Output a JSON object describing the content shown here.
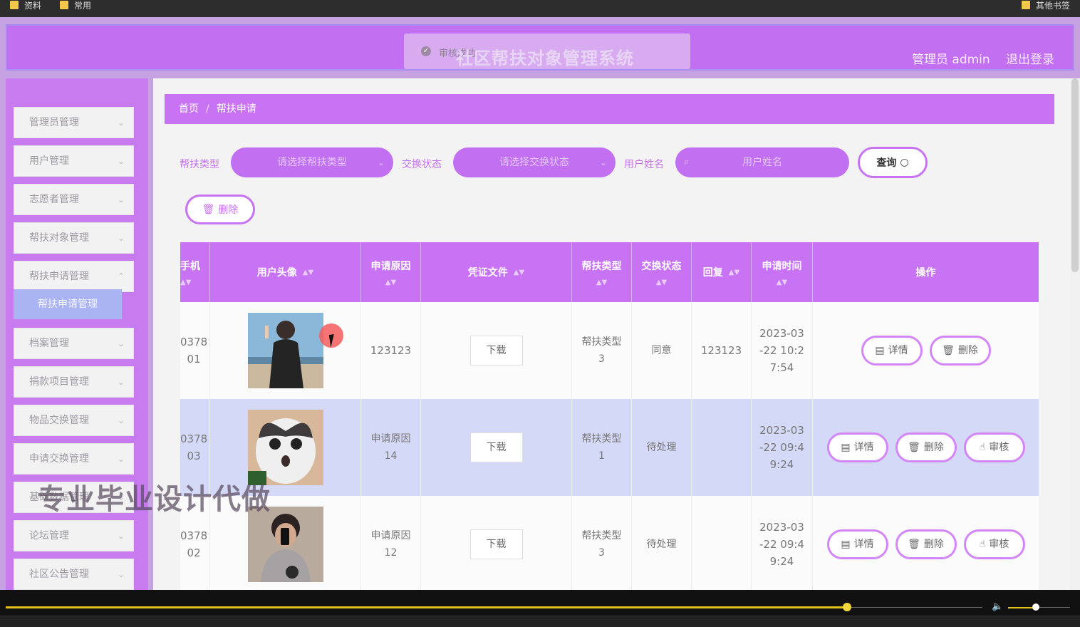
{
  "browser": {
    "bookmarks": [
      "资料",
      "常用"
    ],
    "other_bookmarks": "其他书签"
  },
  "header": {
    "title": "社区帮扶对象管理系统",
    "toast": "审核成功",
    "user": "管理员 admin",
    "logout": "退出登录"
  },
  "sidebar": {
    "items": [
      {
        "label": "管理员管理"
      },
      {
        "label": "用户管理"
      },
      {
        "label": "志愿者管理"
      },
      {
        "label": "帮扶对象管理"
      },
      {
        "label": "帮扶申请管理"
      },
      {
        "label": "档案管理"
      },
      {
        "label": "捐款项目管理"
      },
      {
        "label": "物品交换管理"
      },
      {
        "label": "申请交换管理"
      },
      {
        "label": "基础数据管理"
      },
      {
        "label": "论坛管理"
      },
      {
        "label": "社区公告管理"
      }
    ],
    "active_sub": "帮扶申请管理"
  },
  "watermark": "专业毕业设计代做",
  "breadcrumb": {
    "home": "首页",
    "current": "帮扶申请"
  },
  "filters": {
    "type_label": "帮扶类型",
    "type_placeholder": "请选择帮扶类型",
    "status_label": "交换状态",
    "status_placeholder": "请选择交换状态",
    "name_label": "用户姓名",
    "name_placeholder": "用户姓名",
    "query_button": "查询",
    "delete_button": "删除"
  },
  "table": {
    "columns": [
      "手机",
      "用户头像",
      "申请原因",
      "凭证文件",
      "帮扶类型",
      "交换状态",
      "回复",
      "申请时间",
      "操作"
    ],
    "rows": [
      {
        "phone": "0378\n01",
        "reason": "123123",
        "file": "下载",
        "type": "帮扶类型\n3",
        "status": "同意",
        "reply": "123123",
        "time": "2023-03\n-22 10:2\n7:54",
        "actions": [
          "详情",
          "删除"
        ]
      },
      {
        "phone": "0378\n03",
        "reason": "申请原因\n14",
        "file": "下载",
        "type": "帮扶类型\n1",
        "status": "待处理",
        "reply": "",
        "time": "2023-03\n-22 09:4\n9:24",
        "actions": [
          "详情",
          "删除",
          "审核"
        ]
      },
      {
        "phone": "0378\n02",
        "reason": "申请原因\n12",
        "file": "下载",
        "type": "帮扶类型\n3",
        "status": "待处理",
        "reply": "",
        "time": "2023-03\n-22 09:4\n9:24",
        "actions": [
          "详情",
          "删除",
          "审核"
        ]
      }
    ]
  },
  "colors": {
    "accent": "#c873f4",
    "highlight_row": "#d5d9f8",
    "sub_active": "#aab4f2"
  },
  "player": {
    "progress": 0.78,
    "volume": 0.45
  }
}
